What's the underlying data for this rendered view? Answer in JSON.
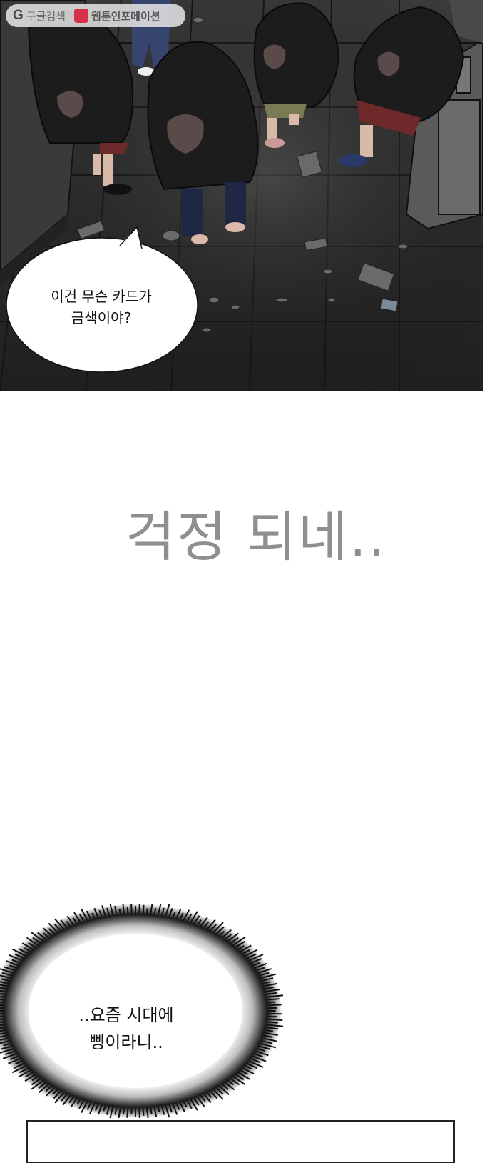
{
  "watermark": {
    "google_glyph": "G",
    "search_label": "구글검색",
    "site_label": "웹툰인포메이션"
  },
  "panel1": {
    "bubble_line1": "이건 무슨 카드가",
    "bubble_line2": "금색이야?"
  },
  "narration": {
    "text": "걱정 되네.."
  },
  "spiky_bubble": {
    "line1": "..요즘 시대에",
    "line2": "삥이라니.."
  },
  "colors": {
    "panel_dark": "#2b2b2b",
    "narration_gray": "#8f8f8f",
    "hoodie": "#1c1c1c",
    "skirt_red": "#6e2a2a"
  }
}
